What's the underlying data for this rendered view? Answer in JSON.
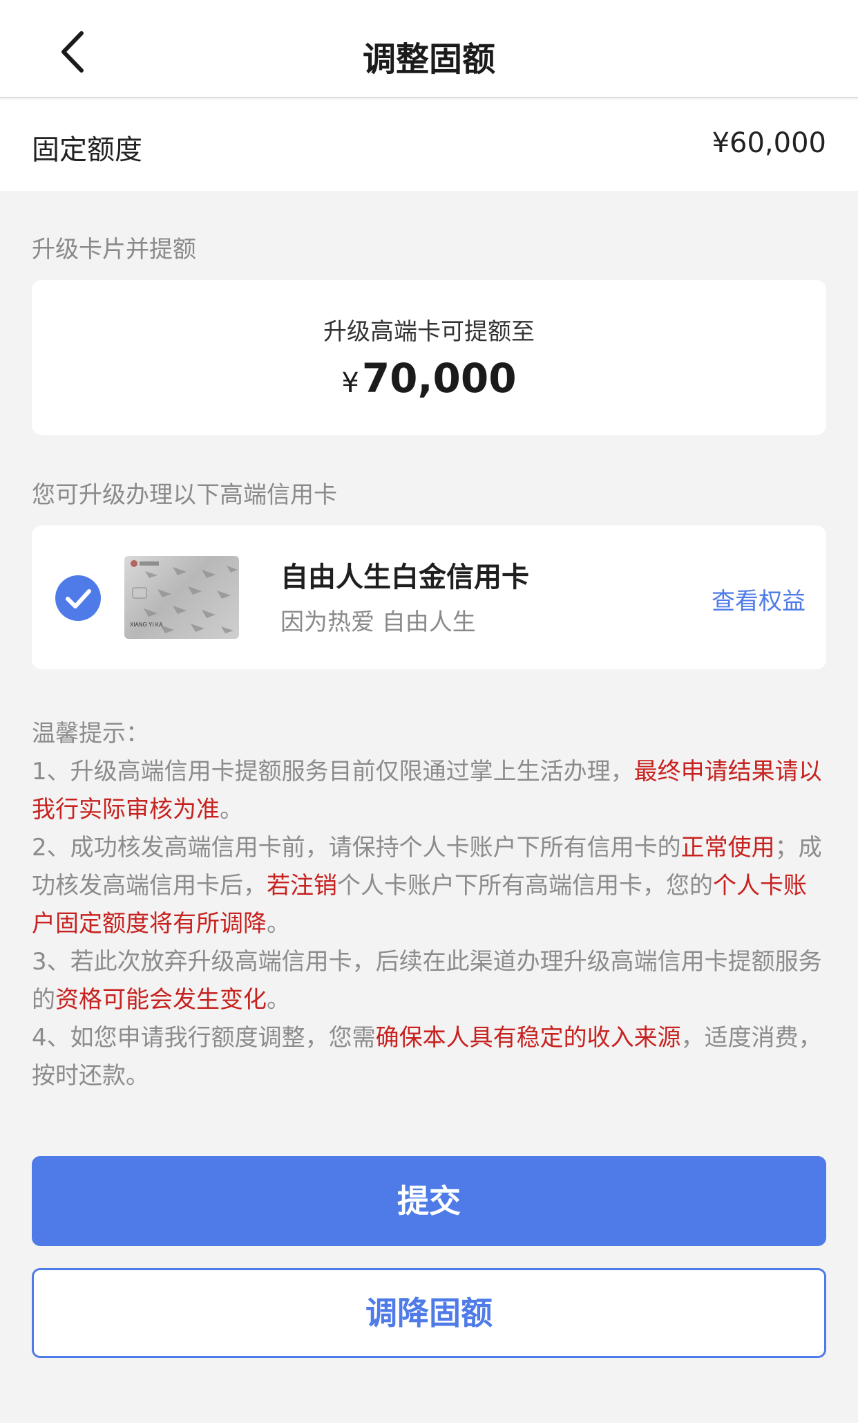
{
  "nav": {
    "title": "调整固额",
    "back_icon": "chevron-left-icon"
  },
  "fixed_limit": {
    "label": "固定额度",
    "value": "¥60,000"
  },
  "upgrade": {
    "section_label": "升级卡片并提额",
    "subtitle": "升级高端卡可提额至",
    "currency": "¥",
    "amount": "70,000"
  },
  "card_select": {
    "section_label": "您可升级办理以下高端信用卡",
    "card_name": "自由人生白金信用卡",
    "slogan": "因为热爱 自由人生",
    "link": "查看权益",
    "checked": true,
    "card_image_label": "XIANG YI KA"
  },
  "tips": {
    "heading": "温馨提示：",
    "items": [
      [
        {
          "t": "1、升级高端信用卡提额服务目前仅限通过掌上生活办理，",
          "hl": false
        },
        {
          "t": "最终申请结果请以我行实际审核为准",
          "hl": true
        },
        {
          "t": "。",
          "hl": false
        }
      ],
      [
        {
          "t": "2、成功核发高端信用卡前，请保持个人卡账户下所有信用卡的",
          "hl": false
        },
        {
          "t": "正常使用",
          "hl": true
        },
        {
          "t": "；成功核发高端信用卡后，",
          "hl": false
        },
        {
          "t": "若注销",
          "hl": true
        },
        {
          "t": "个人卡账户下所有高端信用卡，您的",
          "hl": false
        },
        {
          "t": "个人卡账户固定额度将有所调降",
          "hl": true
        },
        {
          "t": "。",
          "hl": false
        }
      ],
      [
        {
          "t": "3、若此次放弃升级高端信用卡，后续在此渠道办理升级高端信用卡提额服务的",
          "hl": false
        },
        {
          "t": "资格可能会发生变化",
          "hl": true
        },
        {
          "t": "。",
          "hl": false
        }
      ],
      [
        {
          "t": "4、如您申请我行额度调整，您需",
          "hl": false
        },
        {
          "t": "确保本人具有稳定的收入来源",
          "hl": true
        },
        {
          "t": "，适度消费，按时还款。",
          "hl": false
        }
      ]
    ]
  },
  "buttons": {
    "submit": "提交",
    "decrease": "调降固额"
  },
  "colors": {
    "accent": "#4e7be8",
    "highlight": "#c7221f",
    "muted": "#8c8c8c"
  }
}
